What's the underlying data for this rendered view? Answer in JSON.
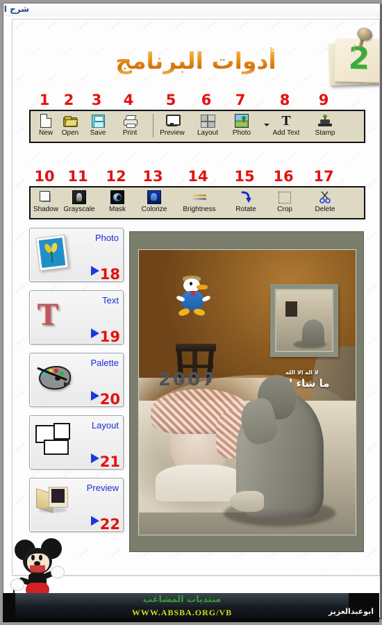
{
  "window": {
    "title": "شرح البرنامج"
  },
  "header": {
    "title": "أدوات البرنامج",
    "note_number": "2"
  },
  "toolbar_top": {
    "numbers": [
      "1",
      "2",
      "3",
      "4",
      "5",
      "6",
      "7",
      "8",
      "9"
    ],
    "buttons": [
      {
        "label": "New",
        "icon": "new-page-icon"
      },
      {
        "label": "Open",
        "icon": "open-folder-icon"
      },
      {
        "label": "Save",
        "icon": "floppy-disk-icon"
      },
      {
        "label": "Print",
        "icon": "printer-icon"
      },
      {
        "label": "Preview",
        "icon": "monitor-icon"
      },
      {
        "label": "Layout",
        "icon": "layout-grid-icon"
      },
      {
        "label": "Photo",
        "icon": "photo-thumbnail-icon"
      },
      {
        "label": "Add Text",
        "icon": "text-t-icon"
      },
      {
        "label": "Stamp",
        "icon": "rubber-stamp-icon"
      }
    ]
  },
  "toolbar_bottom": {
    "numbers": [
      "10",
      "11",
      "12",
      "13",
      "14",
      "15",
      "16",
      "17"
    ],
    "buttons": [
      {
        "label": "Shadow",
        "icon": "drop-shadow-square-icon"
      },
      {
        "label": "Grayscale",
        "icon": "grayscale-photo-icon"
      },
      {
        "label": "Mask",
        "icon": "mask-swirl-icon"
      },
      {
        "label": "Colorize",
        "icon": "colorize-blue-icon"
      },
      {
        "label": "Brightness",
        "icon": "brightness-gradient-icon"
      },
      {
        "label": "Rotate",
        "icon": "rotate-arrow-icon"
      },
      {
        "label": "Crop",
        "icon": "crop-dotted-square-icon"
      },
      {
        "label": "Delete",
        "icon": "scissors-icon"
      }
    ]
  },
  "sidebar": {
    "panels": [
      {
        "label": "Photo",
        "number": "18",
        "icon": "photo-flower-icon"
      },
      {
        "label": "Text",
        "number": "19",
        "icon": "text-t-3d-icon"
      },
      {
        "label": "Palette",
        "number": "20",
        "icon": "paint-palette-icon"
      },
      {
        "label": "Layout",
        "number": "21",
        "icon": "layout-boxes-icon"
      },
      {
        "label": "Preview",
        "number": "22",
        "icon": "monitor-preview-icon"
      }
    ]
  },
  "canvas": {
    "artwork_text_small": "لا اله الا الله",
    "artwork_text_big": "ما شاء الله"
  },
  "year": "2007",
  "footer": {
    "forum": "منتديات المشاغب",
    "url": "WWW.ABSBA.ORG/VB",
    "author": "ابوعبدالعزيز"
  },
  "colors": {
    "number_red": "#e2120f",
    "title_orange": "#e8921c",
    "panel_label_blue": "#1b2bd0",
    "footer_green": "#2fa12f",
    "footer_yellow": "#d8d81e",
    "toolbar_bg": "#ded9c3"
  },
  "watermark_text": "المشاغب"
}
